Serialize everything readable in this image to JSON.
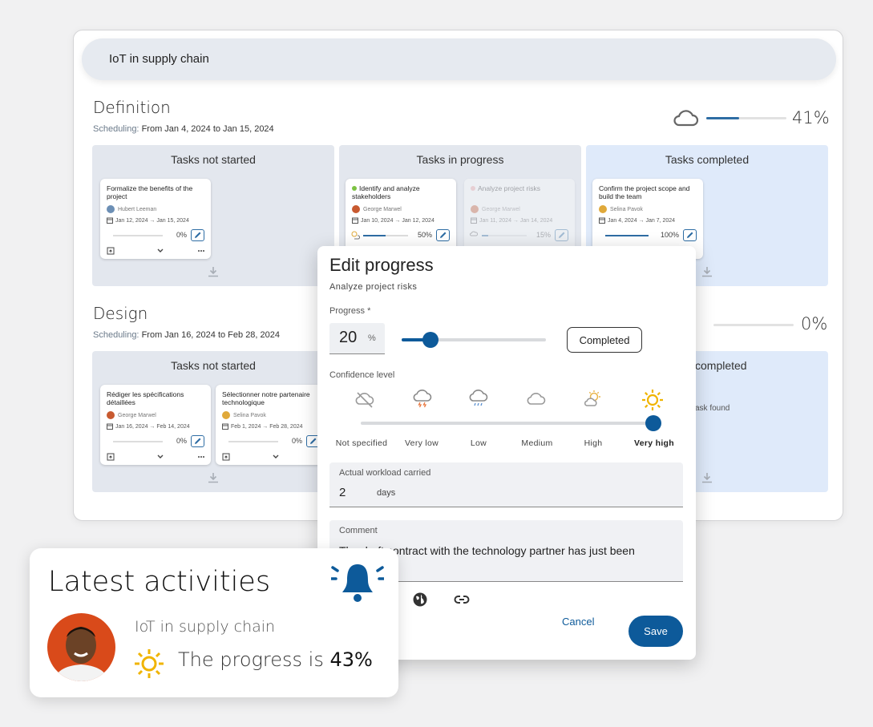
{
  "project": {
    "name": "IoT in supply chain"
  },
  "phases": [
    {
      "title": "Definition",
      "scheduling_label": "Scheduling:",
      "scheduling_range": "From Jan 4, 2024 to Jan 15, 2024",
      "progress": "41%",
      "progress_value": 41,
      "columns": {
        "not_started": {
          "title": "Tasks not started",
          "cards": [
            {
              "title": "Formalize the benefits of the project",
              "assignee": "Hubert Leeman",
              "dates": "Jan 12, 2024 → Jan 15, 2024",
              "progress": "0%",
              "progress_value": 0
            }
          ]
        },
        "in_progress": {
          "title": "Tasks in progress",
          "cards": [
            {
              "title": "Identify and analyze stakeholders",
              "assignee": "George Marwel",
              "dates": "Jan 10, 2024 → Jan 12, 2024",
              "progress": "50%",
              "progress_value": 50
            },
            {
              "title": "Analyze project risks",
              "assignee": "George Marwel",
              "dates": "Jan 11, 2024 → Jan 14, 2024",
              "progress": "15%",
              "progress_value": 15
            }
          ]
        },
        "completed": {
          "title": "Tasks completed",
          "cards": [
            {
              "title": "Confirm the project scope and build the team",
              "assignee": "Selina Pavok",
              "dates": "Jan 4, 2024 → Jan 7, 2024",
              "progress": "100%",
              "progress_value": 100
            }
          ]
        }
      }
    },
    {
      "title": "Design",
      "scheduling_label": "Scheduling:",
      "scheduling_range": "From Jan 16, 2024 to Feb 28, 2024",
      "progress": "0%",
      "progress_value": 0,
      "columns": {
        "not_started": {
          "title": "Tasks not started",
          "cards": [
            {
              "title": "Rédiger les spécifications détaillées",
              "assignee": "George Marwel",
              "dates": "Jan 16, 2024 → Feb 14, 2024",
              "progress": "0%",
              "progress_value": 0
            },
            {
              "title": "Sélectionner notre partenaire technologique",
              "assignee": "Selina Pavok",
              "dates": "Feb 1, 2024 → Feb 28, 2024",
              "progress": "0%",
              "progress_value": 0
            }
          ]
        },
        "completed": {
          "title_fragment": "completed",
          "empty_fragment": "ask found"
        }
      }
    }
  ],
  "edit_progress": {
    "title": "Edit progress",
    "task": "Analyze project risks",
    "progress_label": "Progress *",
    "progress_value": "20",
    "progress_unit": "%",
    "progress_fraction": 0.2,
    "completed_button": "Completed",
    "confidence_label": "Confidence level",
    "confidence_levels": [
      "Not specified",
      "Very low",
      "Low",
      "Medium",
      "High",
      "Very high"
    ],
    "confidence_selected": "Very high",
    "workload_label": "Actual workload carried",
    "workload_value": "2",
    "workload_unit": "days",
    "comment_label": "Comment",
    "comment_value": "The draft contract with the technology partner has just been",
    "cancel_label": "Cancel",
    "save_label": "Save"
  },
  "activity": {
    "title": "Latest activities",
    "project": "IoT in supply chain",
    "message_prefix": "The progress is",
    "message_value": "43%"
  },
  "colors": {
    "accent": "#0d5a9a",
    "sun": "#f0b400",
    "bell": "#0d5a9a"
  }
}
